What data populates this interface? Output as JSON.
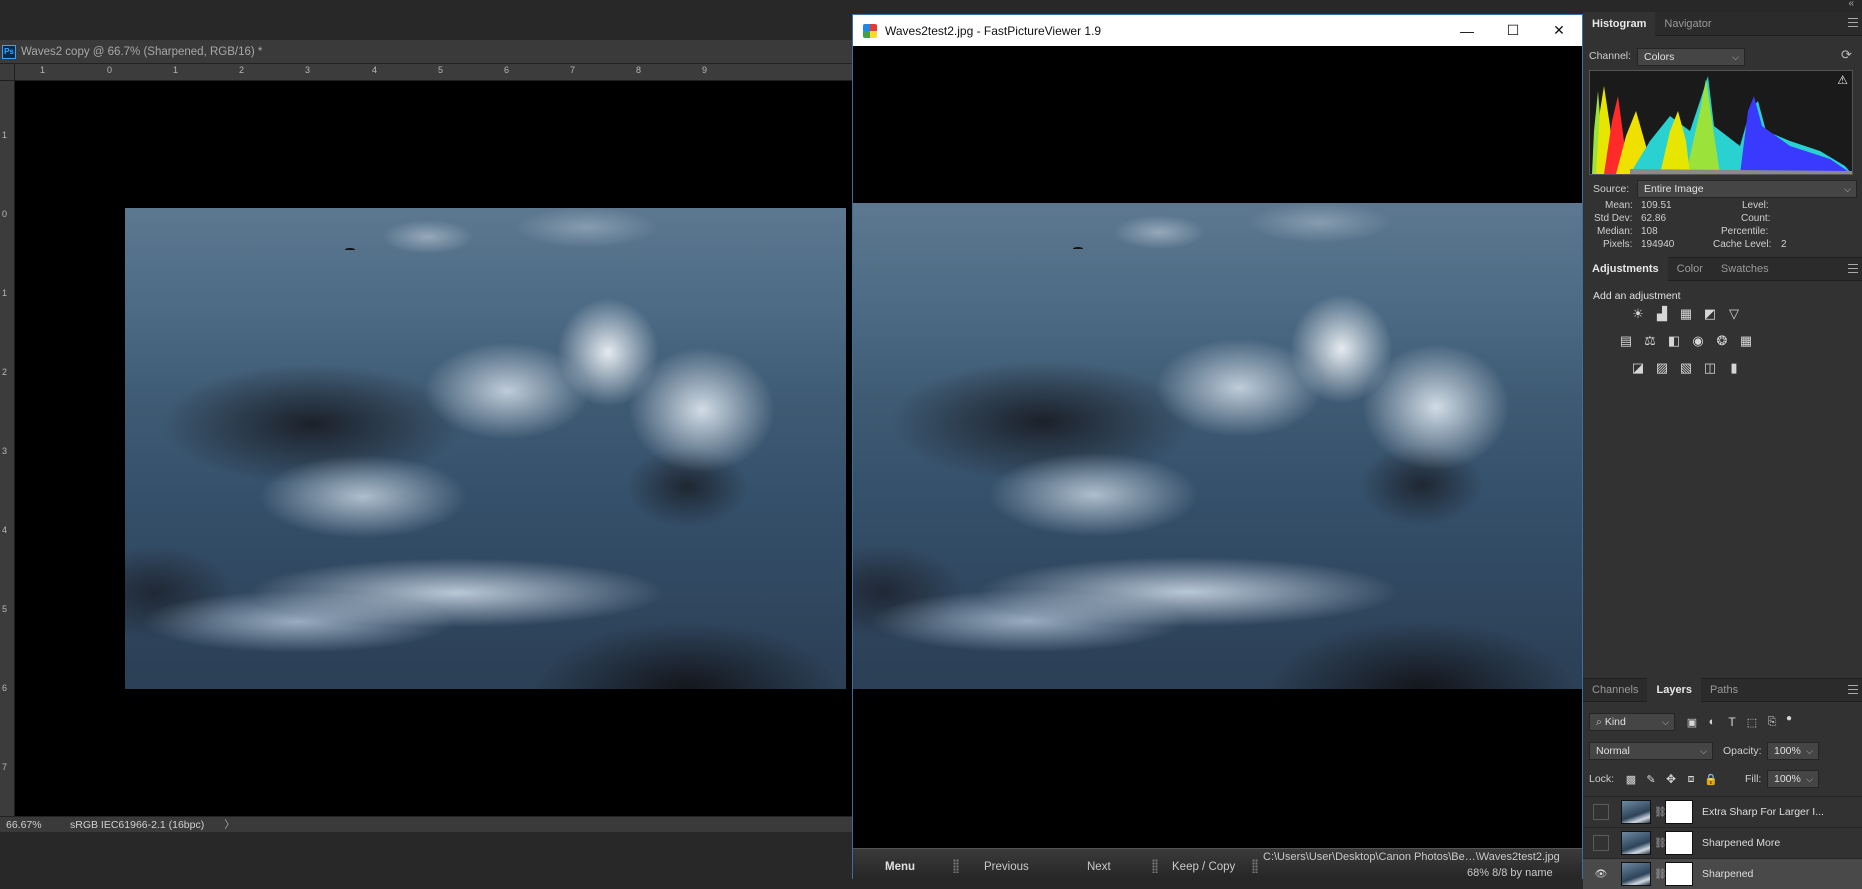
{
  "photoshop": {
    "document_tab": "Waves2 copy @ 66.7% (Sharpened, RGB/16) *",
    "app_badge": "Ps",
    "ruler_top_labels": [
      "1",
      "0",
      "1",
      "2",
      "3",
      "4",
      "5",
      "6",
      "7",
      "8",
      "9"
    ],
    "ruler_left_labels": [
      "1",
      "0",
      "1",
      "2",
      "3",
      "4",
      "5",
      "6",
      "7"
    ],
    "status": {
      "zoom": "66.67%",
      "profile": "sRGB IEC61966-2.1 (16bpc)",
      "arrow": "〉"
    }
  },
  "fpv": {
    "title": "Waves2test2.jpg - FastPictureViewer 1.9",
    "buttons": {
      "minimize": "—",
      "maximize": "☐",
      "close": "✕"
    },
    "bottom_bar": {
      "menu": "Menu",
      "previous": "Previous",
      "next": "Next",
      "keep_copy": "Keep / Copy",
      "path": "C:\\Users\\User\\Desktop\\Canon Photos\\Be…\\Waves2test2.jpg",
      "info": "68%  8/8  by name"
    }
  },
  "histogram": {
    "tabs": [
      "Histogram",
      "Navigator"
    ],
    "channel_label": "Channel:",
    "channel_value": "Colors",
    "source_label": "Source:",
    "source_value": "Entire Image",
    "stats_left": [
      {
        "label": "Mean:",
        "value": "109.51"
      },
      {
        "label": "Std Dev:",
        "value": "62.86"
      },
      {
        "label": "Median:",
        "value": "108"
      },
      {
        "label": "Pixels:",
        "value": "194940"
      }
    ],
    "stats_right": [
      {
        "label": "Level:",
        "value": ""
      },
      {
        "label": "Count:",
        "value": ""
      },
      {
        "label": "Percentile:",
        "value": ""
      },
      {
        "label": "Cache Level:",
        "value": "2"
      }
    ],
    "warning": "⚠"
  },
  "adjustments": {
    "tabs": [
      "Adjustments",
      "Color",
      "Swatches"
    ],
    "heading": "Add an adjustment",
    "icons_row1": [
      "brightness-contrast-icon",
      "levels-icon",
      "curves-icon",
      "exposure-icon",
      "vibrance-icon"
    ],
    "icons_row2": [
      "hue-saturation-icon",
      "color-balance-icon",
      "black-white-icon",
      "photo-filter-icon",
      "channel-mixer-icon",
      "color-lookup-icon"
    ],
    "icons_row3": [
      "invert-icon",
      "posterize-icon",
      "threshold-icon",
      "selective-color-icon",
      "gradient-map-icon"
    ]
  },
  "layers": {
    "tabs": [
      "Channels",
      "Layers",
      "Paths"
    ],
    "filter_kind": "Kind",
    "blend_mode": "Normal",
    "opacity_label": "Opacity:",
    "opacity_value": "100%",
    "lock_label": "Lock:",
    "fill_label": "Fill:",
    "fill_value": "100%",
    "items": [
      {
        "name": "Extra Sharp For Larger I...",
        "visible": false
      },
      {
        "name": "Sharpened More",
        "visible": false
      },
      {
        "name": "Sharpened",
        "visible": true
      }
    ],
    "eye": "👁"
  }
}
